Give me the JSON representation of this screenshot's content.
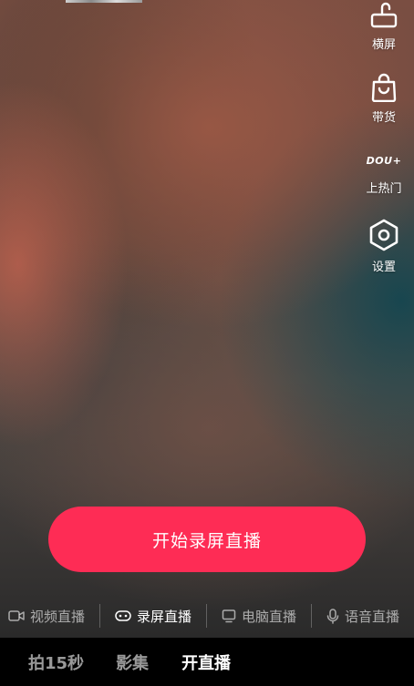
{
  "side_menu": {
    "rotate_label": "横屏",
    "shop_label": "带货",
    "dou_logo": "DOU+",
    "dou_label": "上热门",
    "settings_label": "设置"
  },
  "start_button_label": "开始录屏直播",
  "live_modes": [
    {
      "label": "视频直播",
      "icon": "video-camera-icon",
      "active": false
    },
    {
      "label": "录屏直播",
      "icon": "game-controller-icon",
      "active": true
    },
    {
      "label": "电脑直播",
      "icon": "monitor-icon",
      "active": false
    },
    {
      "label": "语音直播",
      "icon": "microphone-icon",
      "active": false
    }
  ],
  "bottom_tabs": [
    {
      "label": "拍15秒",
      "active": false
    },
    {
      "label": "影集",
      "active": false
    },
    {
      "label": "开直播",
      "active": true
    }
  ],
  "colors": {
    "accent": "#fe2c55",
    "bottom_bar": "#000000"
  }
}
